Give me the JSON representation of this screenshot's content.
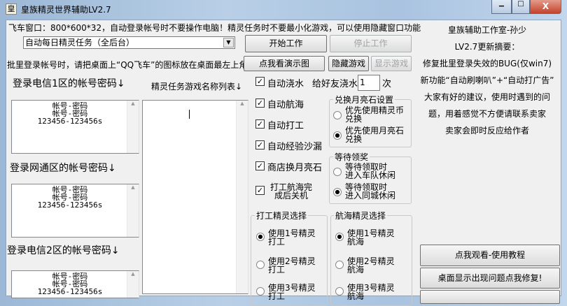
{
  "window": {
    "title": "皇族精灵世界辅助LV2.7",
    "icon": "皇",
    "minimize": "▁",
    "maximize": "□",
    "close": "X"
  },
  "top": {
    "info": "飞车窗口：800*600*32，自动登录帐号时不要操作电脑！精灵任务时不要最小化游戏，可以使用隐藏窗口功能",
    "mode_select": "自动每日精灵任务（全后台）",
    "start": "开始工作",
    "stop": "停止工作",
    "batch_info": "批里登录帐号时，请把桌面上“QQ飞车”的图标放在桌面最左上角！",
    "demo": "点我看演示图",
    "hide_game": "隐藏游戏",
    "show_game": "显示游戏"
  },
  "accounts": [
    {
      "label": "登录电信1区的帐号密码↓",
      "lines": [
        "帐号-密码",
        "帐号-密码",
        "123456-123456s"
      ]
    },
    {
      "label": "登录网通区的帐号密码↓",
      "lines": [
        "帐号-密码",
        "帐号-密码",
        "123456-123456s"
      ]
    },
    {
      "label": "登录电信2区的帐号密码↓",
      "lines": [
        "帐号-密码",
        "帐号-密码",
        "123456-123456s"
      ]
    }
  ],
  "game_list": {
    "label": "精灵任务游戏名称列表↓",
    "value": ""
  },
  "options": {
    "checkboxes": [
      {
        "label": "自动浇水",
        "checked": true
      },
      {
        "label": "自动航海",
        "checked": true
      },
      {
        "label": "自动打工",
        "checked": true
      },
      {
        "label": "自动经验沙漏",
        "checked": true
      },
      {
        "label": "商店换月亮石",
        "checked": true
      },
      {
        "label": "打工航海完",
        "label2": "成后关机",
        "checked": true
      }
    ],
    "water_friend_label": "给好友浇水",
    "water_friend_count": "1",
    "water_unit": "次"
  },
  "moonstone": {
    "title": "兑换月亮石设置",
    "options": [
      {
        "l1": "优先使用精灵币",
        "l2": "兑换",
        "selected": false
      },
      {
        "l1": "优先使用月亮石",
        "l2": "兑换",
        "selected": true
      }
    ]
  },
  "wait_reward": {
    "title": "等待领奖",
    "options": [
      {
        "l1": "等待领取时",
        "l2": "进入车队休闲",
        "selected": false
      },
      {
        "l1": "等待领取时",
        "l2": "进入同城休闲",
        "selected": true
      }
    ]
  },
  "work_sprite": {
    "title": "打工精灵选择",
    "options": [
      {
        "l1": "使用1号精灵",
        "l2": "打工",
        "selected": true
      },
      {
        "l1": "使用2号精灵",
        "l2": "打工",
        "selected": false
      },
      {
        "l1": "使用3号精灵",
        "l2": "打工",
        "selected": false
      }
    ]
  },
  "sail_sprite": {
    "title": "航海精灵选择",
    "options": [
      {
        "l1": "使用1号精灵",
        "l2": "航海",
        "selected": true
      },
      {
        "l1": "使用2号精灵",
        "l2": "航海",
        "selected": false
      },
      {
        "l1": "使用3号精灵",
        "l2": "航海",
        "selected": false
      }
    ]
  },
  "notes": [
    "皇族辅助工作室-孙少",
    "LV2.7更新摘要：",
    "修复批里登录失效的BUG(仅win7)",
    "新功能“自动刷喇叭”+“自动打广告”",
    "大家有好的建议，使用时遇到的问",
    "题，用着感觉不方便请联系卖家",
    "卖家会即时反应给作者"
  ],
  "right_buttons": {
    "tutorial": "点我观看-使用教程",
    "fix_desktop": "桌面显示出现问题点我修复!"
  }
}
